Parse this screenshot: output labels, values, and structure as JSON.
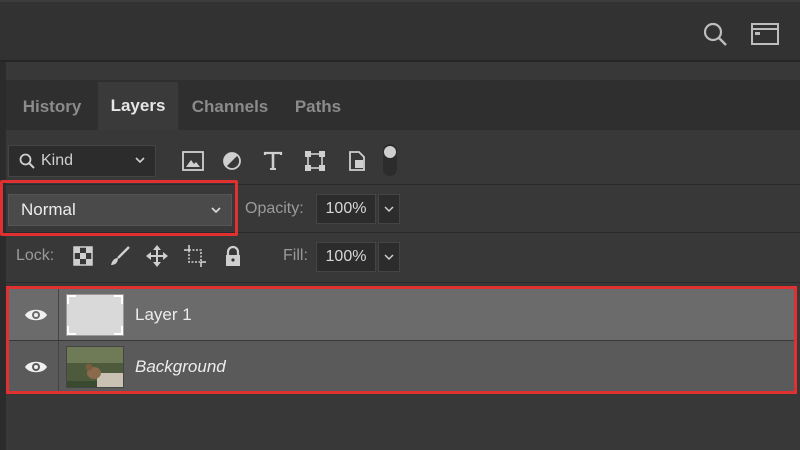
{
  "toolbar": {
    "icons": [
      "search-icon",
      "panel-toggle-icon"
    ]
  },
  "tabs": [
    {
      "label": "History",
      "active": false
    },
    {
      "label": "Layers",
      "active": true
    },
    {
      "label": "Channels",
      "active": false
    },
    {
      "label": "Paths",
      "active": false
    }
  ],
  "filter": {
    "kind_label": "Kind",
    "icons": [
      "pixel-layer-filter-icon",
      "adjustment-layer-filter-icon",
      "type-layer-filter-icon",
      "shape-layer-filter-icon",
      "smart-object-filter-icon"
    ]
  },
  "blend": {
    "mode": "Normal",
    "opacity_label": "Opacity:",
    "opacity_value": "100%"
  },
  "lock": {
    "label": "Lock:",
    "icons": [
      "lock-transparent-pixels-icon",
      "lock-image-pixels-icon",
      "lock-position-icon",
      "prevent-auto-nesting-icon",
      "lock-all-icon"
    ],
    "fill_label": "Fill:",
    "fill_value": "100%"
  },
  "layers": [
    {
      "name": "Layer 1",
      "visible": true,
      "selected": true
    },
    {
      "name": "Background",
      "visible": true,
      "selected": false
    }
  ],
  "colors": {
    "highlight": "#e03030",
    "panel": "#383838",
    "selected_layer": "#6b6b6b"
  }
}
